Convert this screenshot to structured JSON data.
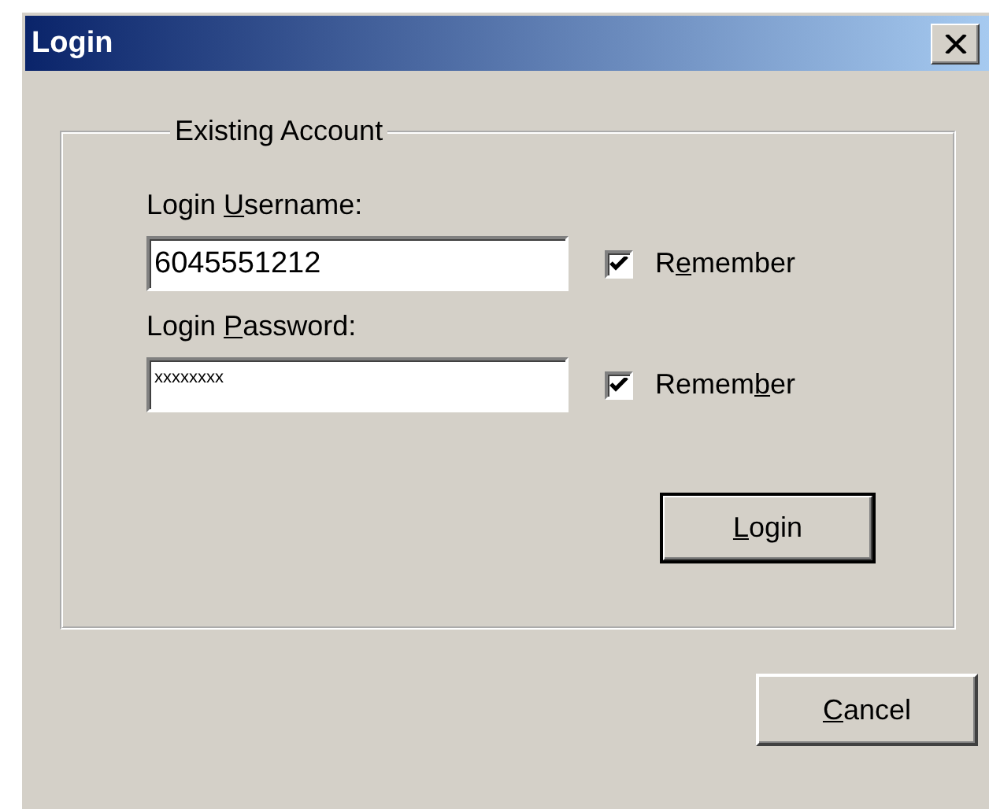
{
  "window": {
    "title": "Login"
  },
  "group": {
    "title": "Existing Account"
  },
  "fields": [
    {
      "label": {
        "before": "Login ",
        "key": "U",
        "after": "sername:"
      },
      "kind": "text",
      "value": "6045551212",
      "remember": {
        "label": {
          "before": "R",
          "key": "e",
          "after": "member"
        },
        "checked": true
      }
    },
    {
      "label": {
        "before": "Login ",
        "key": "P",
        "after": "assword:"
      },
      "kind": "password",
      "value": "xxxxxxxx",
      "remember": {
        "label": {
          "before": "Remem",
          "key": "b",
          "after": "er"
        },
        "checked": true
      }
    }
  ],
  "login_button": {
    "label": {
      "key": "L",
      "after": "ogin"
    },
    "default": true
  },
  "cancel_button": {
    "label": {
      "key": "C",
      "after": "ancel"
    },
    "default": false
  }
}
